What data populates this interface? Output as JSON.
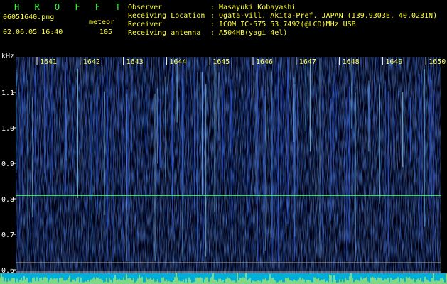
{
  "app": {
    "title": "H R O F F T"
  },
  "file": {
    "name": "06051640.png",
    "date": "02.06.05 16:40",
    "mode": "meteor",
    "count": "105"
  },
  "info": {
    "observer_label": "Observer",
    "observer_value": ": Masayuki Kobayashi",
    "location_label": "Receiving Location",
    "location_value": ": Ogata-vill. Akita-Pref. JAPAN (139.9303E, 40.0231N)",
    "receiver_label": "Receiver",
    "receiver_value": ": ICOM IC-575 53.7492(@LCD)MHz USB",
    "antenna_label": "Receiving antenna",
    "antenna_value": ": A504HB(yagi 4el)"
  },
  "axes": {
    "y_unit": "kHz",
    "y_ticks": [
      "1.1",
      "1.0",
      "0.9",
      "0.8",
      "0.7",
      "0.6"
    ],
    "x_ticks": [
      "1641",
      "1642",
      "1643",
      "1644",
      "1645",
      "1646",
      "1647",
      "1648",
      "1649",
      "1650"
    ]
  },
  "colors": {
    "header": "#ffff33",
    "app": "#33ff33",
    "signal": "#66ff88",
    "noise": "#1a3cc8"
  }
}
